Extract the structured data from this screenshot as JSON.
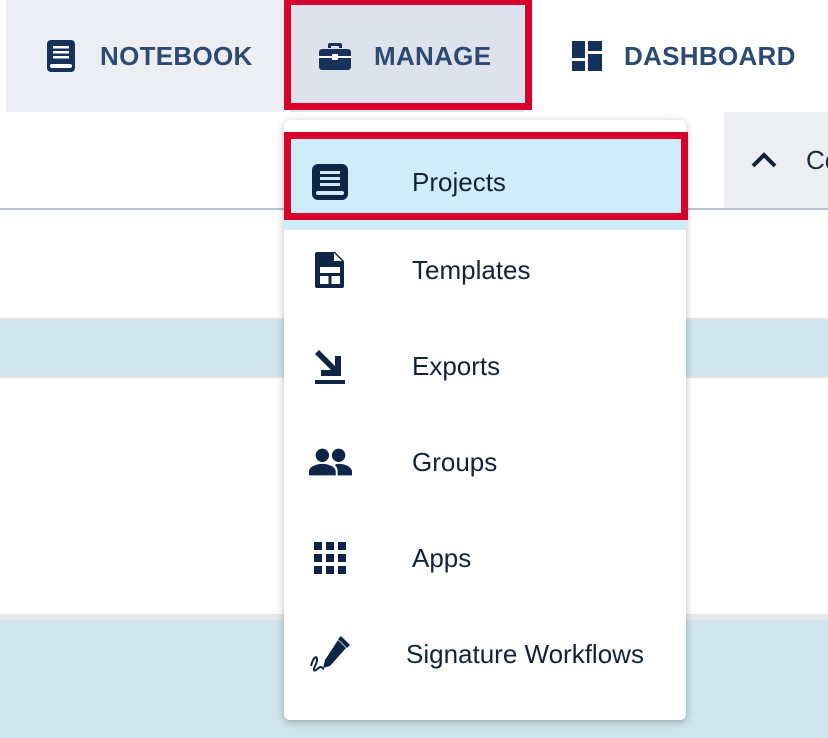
{
  "nav": {
    "tabs": [
      {
        "label": "NOTEBOOK",
        "icon": "book-icon"
      },
      {
        "label": "MANAGE",
        "icon": "briefcase-icon"
      },
      {
        "label": "DASHBOARD",
        "icon": "dashboard-icon"
      }
    ],
    "active_tab": "MANAGE"
  },
  "collapse_button": {
    "label": "Co",
    "icon": "chevron-up-icon"
  },
  "menu": {
    "items": [
      {
        "label": "Projects",
        "icon": "book-icon"
      },
      {
        "label": "Templates",
        "icon": "template-icon"
      },
      {
        "label": "Exports",
        "icon": "export-icon"
      },
      {
        "label": "Groups",
        "icon": "groups-icon"
      },
      {
        "label": "Apps",
        "icon": "apps-grid-icon"
      },
      {
        "label": "Signature Workflows",
        "icon": "signature-icon"
      }
    ],
    "highlighted_item": "Projects"
  },
  "colors": {
    "nav_text": "#2c4a72",
    "highlight": "#d8002c",
    "active_item_bg": "#cfecf9",
    "band": "#cfe4ec"
  }
}
